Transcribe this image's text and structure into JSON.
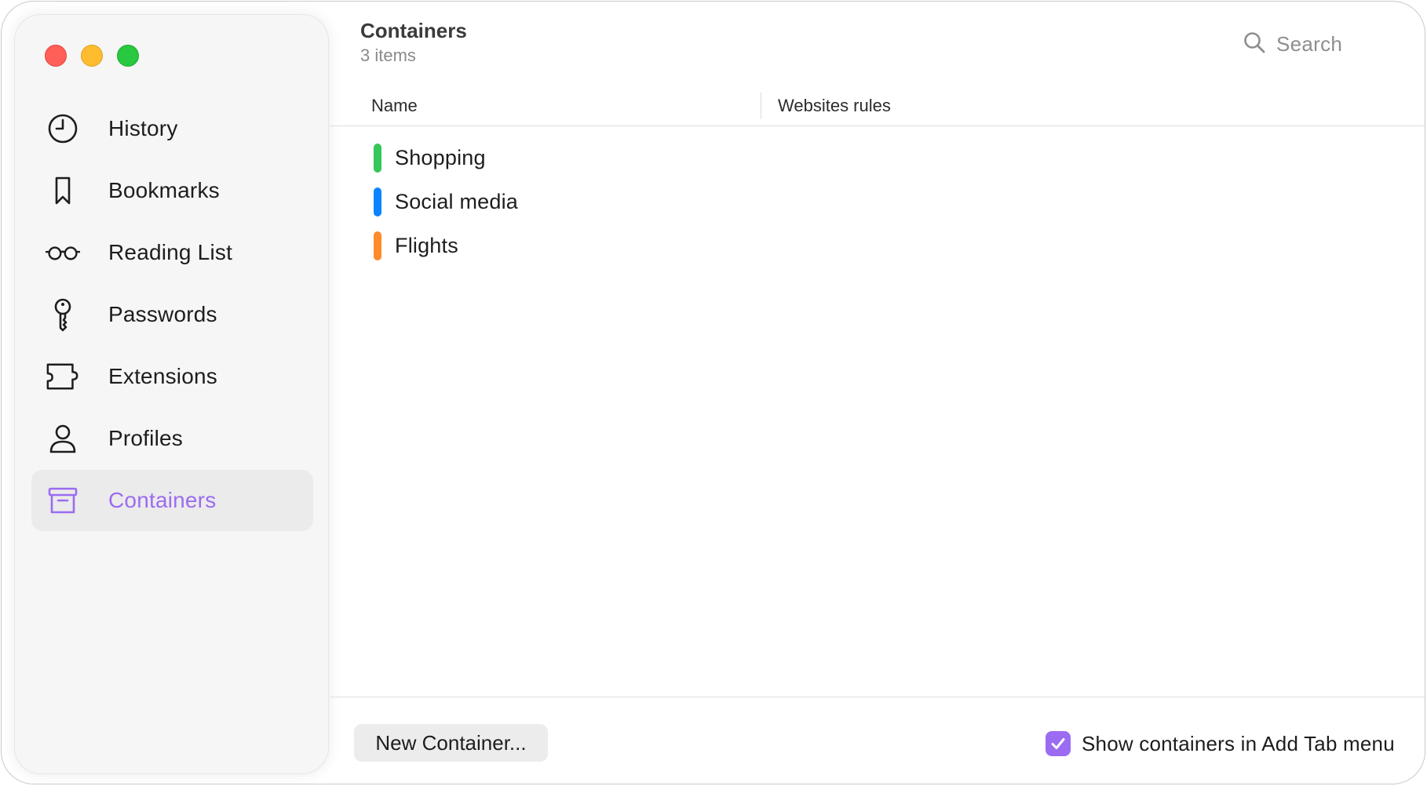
{
  "window": {
    "controls": [
      "close",
      "minimize",
      "maximize"
    ]
  },
  "sidebar": {
    "items": [
      {
        "label": "History",
        "icon": "clock-icon",
        "active": false
      },
      {
        "label": "Bookmarks",
        "icon": "bookmark-icon",
        "active": false
      },
      {
        "label": "Reading List",
        "icon": "glasses-icon",
        "active": false
      },
      {
        "label": "Passwords",
        "icon": "key-icon",
        "active": false
      },
      {
        "label": "Extensions",
        "icon": "puzzle-icon",
        "active": false
      },
      {
        "label": "Profiles",
        "icon": "person-icon",
        "active": false
      },
      {
        "label": "Containers",
        "icon": "archive-box-icon",
        "active": true
      }
    ]
  },
  "main": {
    "title": "Containers",
    "subtitle": "3 items",
    "search_label": "Search",
    "columns": [
      "Name",
      "Websites rules"
    ],
    "rows": [
      {
        "name": "Shopping",
        "color": "#34c759"
      },
      {
        "name": "Social media",
        "color": "#0a84ff"
      },
      {
        "name": "Flights",
        "color": "#ff8a2a"
      }
    ]
  },
  "footer": {
    "new_button_label": "New Container...",
    "checkbox_label": "Show containers in Add Tab menu",
    "checkbox_checked": true
  },
  "colors": {
    "accent": "#9b6cf2",
    "close": "#ff5f57",
    "minimize": "#febc2e",
    "maximize": "#28c840"
  }
}
